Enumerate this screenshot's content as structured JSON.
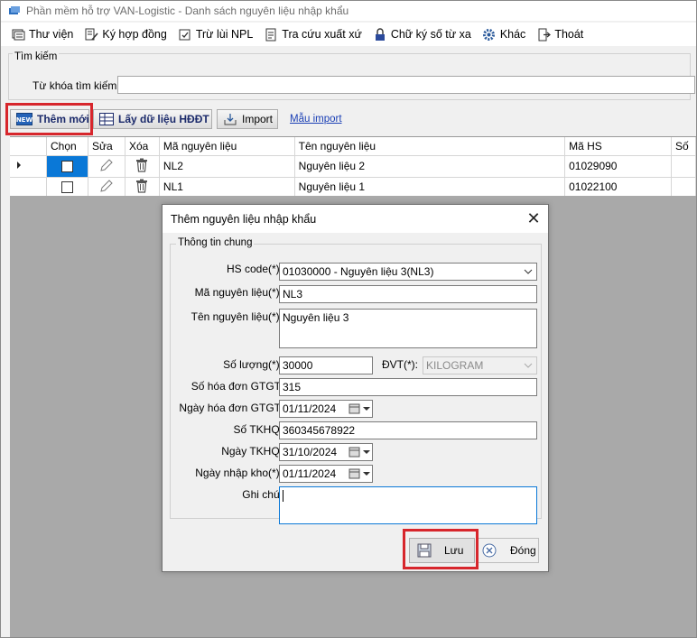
{
  "window": {
    "title": "Phần mềm hỗ trợ VAN-Logistic - Danh sách nguyên liệu nhập khẩu"
  },
  "menu": [
    {
      "label": "Thư viện",
      "icon": "library-icon"
    },
    {
      "label": "Ký hợp đồng",
      "icon": "sign-contract-icon"
    },
    {
      "label": "Trừ lùi NPL",
      "icon": "deduct-icon"
    },
    {
      "label": "Tra cứu xuất xứ",
      "icon": "lookup-icon"
    },
    {
      "label": "Chữ ký số từ xa",
      "icon": "lock-icon"
    },
    {
      "label": "Khác",
      "icon": "gear-icon"
    },
    {
      "label": "Thoát",
      "icon": "exit-icon"
    }
  ],
  "search": {
    "group_label": "Tìm kiếm",
    "keyword_label": "Từ khóa tìm kiếm:",
    "keyword_value": ""
  },
  "toolbar": {
    "add_label": "Thêm mới",
    "add_icon_text": "NEW",
    "fetch_label": "Lấy dữ liệu HĐĐT",
    "import_label": "Import",
    "template_link": "Mẫu import"
  },
  "grid": {
    "columns": [
      "Chọn",
      "Sửa",
      "Xóa",
      "Mã nguyên liệu",
      "Tên nguyên liệu",
      "Mã HS",
      "Số"
    ],
    "rows": [
      {
        "code": "NL2",
        "name": "Nguyên liệu 2",
        "hs": "01029090",
        "checked": false,
        "current": true
      },
      {
        "code": "NL1",
        "name": "Nguyên liệu 1",
        "hs": "01022100",
        "checked": false,
        "current": false
      }
    ]
  },
  "dialog": {
    "title": "Thêm nguyên liệu nhập khẩu",
    "group_label": "Thông tin chung",
    "fields": {
      "hs_code": {
        "label": "HS code(*):",
        "value": "01030000 - Nguyên liệu 3(NL3)"
      },
      "code": {
        "label": "Mã nguyên liệu(*):",
        "value": "NL3"
      },
      "name": {
        "label": "Tên nguyên liệu(*):",
        "value": "Nguyên liệu 3"
      },
      "quantity": {
        "label": "Số lượng(*):",
        "value": "30000"
      },
      "unit": {
        "label": "ĐVT(*):",
        "value": "KILOGRAM"
      },
      "vat_invoice_no": {
        "label": "Số hóa đơn GTGT:",
        "value": "315"
      },
      "vat_invoice_date": {
        "label": "Ngày hóa đơn GTGT:",
        "value": "01/11/2024"
      },
      "declaration_no": {
        "label": "Số TKHQ:",
        "value": "360345678922"
      },
      "declaration_date": {
        "label": "Ngày TKHQ:",
        "value": "31/10/2024"
      },
      "warehouse_date": {
        "label": "Ngày nhập kho(*):",
        "value": "01/11/2024"
      },
      "note": {
        "label": "Ghi chú:",
        "value": ""
      }
    },
    "save_label": "Lưu",
    "close_label": "Đóng"
  },
  "colors": {
    "highlight": "#d7262c",
    "selection": "#0a78d7",
    "link": "#1a3fb5"
  }
}
